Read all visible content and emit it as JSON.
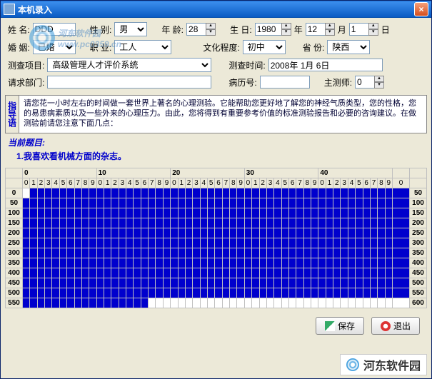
{
  "titlebar": {
    "icon": "app-icon",
    "title": "本机录入"
  },
  "form": {
    "name_lbl": "姓  名:",
    "name_val": "DDD",
    "sex_lbl": "性  别:",
    "sex_val": "男",
    "age_lbl": "年  龄:",
    "age_val": "28",
    "birth_lbl": "生  日:",
    "birth_year": "1980",
    "year_suf": "年",
    "birth_month": "12",
    "month_suf": "月",
    "birth_day": "1",
    "day_suf": "日",
    "marry_lbl": "婚  姻:",
    "marry_val": "已婚",
    "job_lbl": "职  业:",
    "job_val": "工人",
    "edu_lbl": "文化程度:",
    "edu_val": "初中",
    "prov_lbl": "省  份:",
    "prov_val": "陕西",
    "proj_lbl": "测查项目:",
    "proj_val": "高级管理人才评价系统",
    "time_lbl": "测查时间:",
    "time_val": "2008年 1月 6日",
    "dept_lbl": "请求部门:",
    "dept_val": "",
    "case_lbl": "病历号:",
    "case_val": "",
    "tester_lbl": "主测师:",
    "tester_val": "0"
  },
  "watermark": {
    "text": "河东软件园",
    "url": "www.pc0359.cn"
  },
  "guide": {
    "tab": "指导语",
    "text": "请您花一小时左右的时间做一套世界上著名的心理测验。它能帮助您更好地了解您的神经气质类型，您的性格，您的易患病素质以及一些外来的心理压力。由此，您将得到有重要参考价值的标准测验报告和必要的咨询建议。在做测验前请您注意下面几点："
  },
  "current": {
    "head": "当前题目:",
    "q": "1.我喜欢看机械方面的杂志。"
  },
  "chart_data": {
    "type": "table",
    "col_majors": [
      "0",
      "10",
      "20",
      "30",
      "40"
    ],
    "col_minors": [
      "0",
      "1",
      "2",
      "3",
      "4",
      "5",
      "6",
      "7",
      "8",
      "9",
      "0",
      "1",
      "2",
      "3",
      "4",
      "5",
      "6",
      "7",
      "8",
      "9",
      "0",
      "1",
      "2",
      "3",
      "4",
      "5",
      "6",
      "7",
      "8",
      "9",
      "0",
      "1",
      "2",
      "3",
      "4",
      "5",
      "6",
      "7",
      "8",
      "9",
      "0",
      "1",
      "2",
      "3",
      "4",
      "5",
      "6",
      "7",
      "8",
      "9",
      "0"
    ],
    "rows_left": [
      "0",
      "50",
      "100",
      "150",
      "200",
      "250",
      "300",
      "350",
      "400",
      "450",
      "500",
      "550"
    ],
    "rows_right": [
      "50",
      "100",
      "150",
      "200",
      "250",
      "300",
      "350",
      "400",
      "450",
      "500",
      "550",
      "600"
    ],
    "filled": {
      "0": [
        1,
        50
      ],
      "50": [
        0,
        50
      ],
      "100": [
        0,
        50
      ],
      "150": [
        0,
        50
      ],
      "200": [
        0,
        50
      ],
      "250": [
        0,
        50
      ],
      "300": [
        0,
        50
      ],
      "350": [
        0,
        50
      ],
      "400": [
        0,
        50
      ],
      "450": [
        0,
        50
      ],
      "500": [
        0,
        50
      ],
      "550": [
        0,
        16
      ]
    }
  },
  "buttons": {
    "save": "保存",
    "exit": "退出"
  },
  "footer": {
    "site_cn": "河东软件园"
  }
}
